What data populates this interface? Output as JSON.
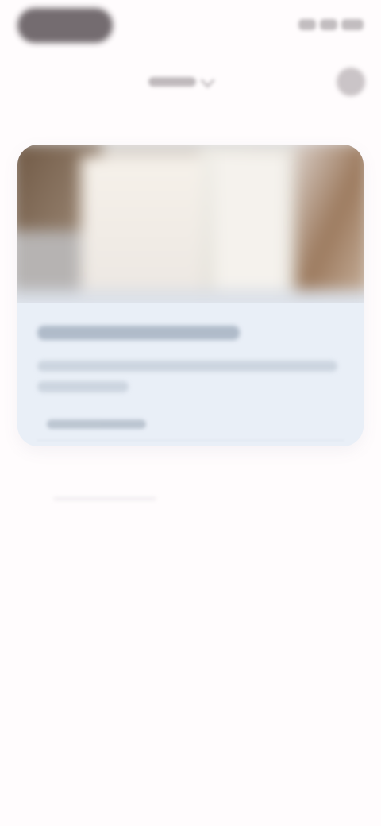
{
  "status_bar": {
    "status_icons": [
      "signal-icon",
      "wifi-icon",
      "battery-icon"
    ]
  },
  "toolbar": {
    "dropdown_label": "",
    "dropdown_icon": "chevron-down-icon",
    "settings_icon": "gear-icon"
  },
  "card": {
    "title": "",
    "description_line_1": "",
    "description_line_2": "",
    "link": ""
  },
  "colors": {
    "background": "#fffcfd",
    "card_background": "#e9eff7",
    "accent": "#aab6c5"
  }
}
